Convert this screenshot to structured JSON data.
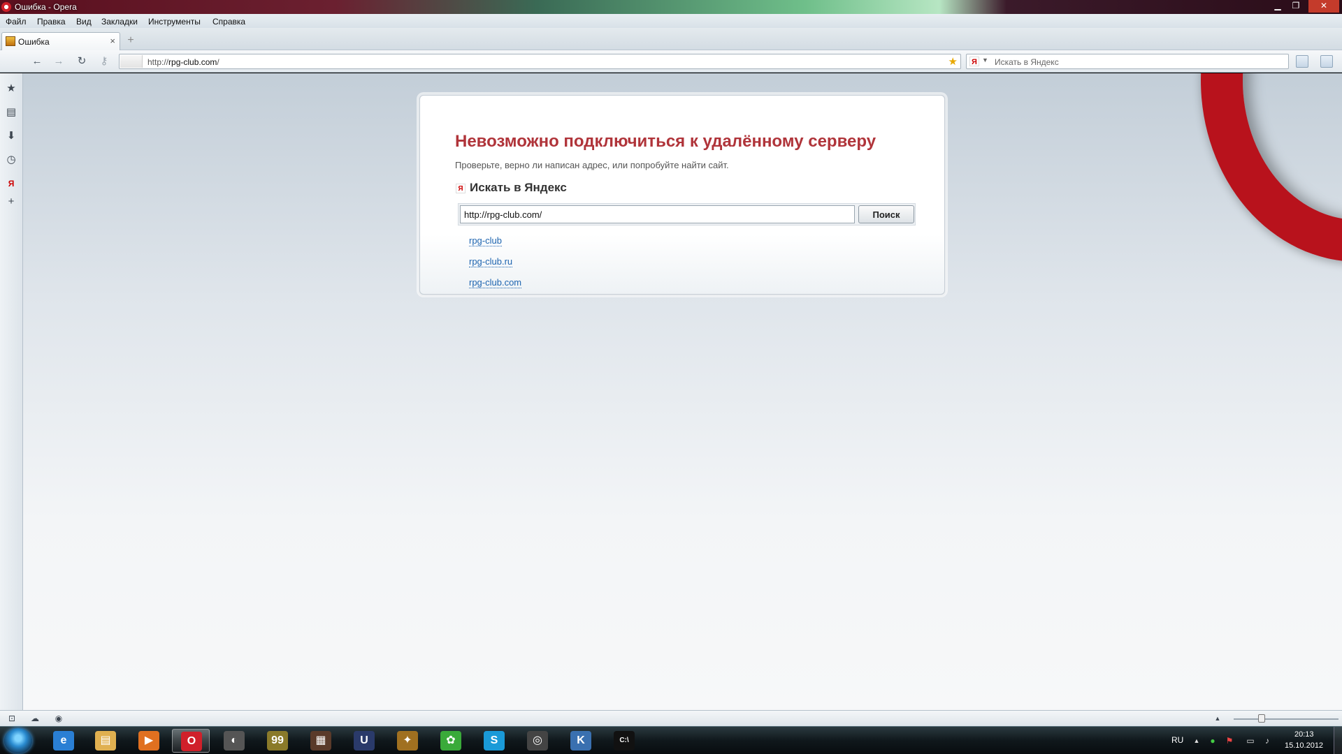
{
  "window": {
    "title": "Ошибка - Opera",
    "minimize": "▁",
    "restore": "❐",
    "close": "✕"
  },
  "menu": [
    "Файл",
    "Правка",
    "Вид",
    "Закладки",
    "Инструменты",
    "Справка"
  ],
  "tab": {
    "title": "Ошибка",
    "close": "×",
    "new_tab": "+"
  },
  "nav": {
    "back": "←",
    "forward": "→",
    "reload": "↻",
    "key": "⚷",
    "url_prefix": "http://",
    "url_host": "rpg-club.com",
    "url_suffix": "/",
    "star": "★",
    "search_engine": "Я",
    "search_dropdown": "▼",
    "search_placeholder": "Искать в Яндекс"
  },
  "sidebar": [
    "★",
    "▤",
    "⬇",
    "◷",
    "Я",
    "+"
  ],
  "error": {
    "title": "Невозможно подключиться к удалённому серверу",
    "subtitle": "Проверьте, верно ли написан адрес, или попробуйте найти сайт.",
    "search_heading": "Искать в Яндекс",
    "yandex_icon": "Я",
    "search_value": "http://rpg-club.com/",
    "search_button": "Поиск",
    "suggestions": [
      "rpg-club",
      "rpg-club.ru",
      "rpg-club.com"
    ]
  },
  "statusbar": {
    "icons": [
      "⊡",
      "☁",
      "◉"
    ],
    "up_arrow": "▲"
  },
  "taskbar": {
    "apps": [
      {
        "name": "ie",
        "glyph": "e",
        "color": "#2a7fd4"
      },
      {
        "name": "explorer",
        "glyph": "▤",
        "color": "#e0b050"
      },
      {
        "name": "media-player",
        "glyph": "▶",
        "color": "#e07020"
      },
      {
        "name": "opera",
        "glyph": "O",
        "color": "#d0202a"
      },
      {
        "name": "steam",
        "glyph": "◐",
        "color": "#555"
      },
      {
        "name": "app-99",
        "glyph": "99",
        "color": "#8a7a2a"
      },
      {
        "name": "game-1",
        "glyph": "▦",
        "color": "#5a3a2a"
      },
      {
        "name": "game-2",
        "glyph": "U",
        "color": "#2a3a6a"
      },
      {
        "name": "game-3",
        "glyph": "✦",
        "color": "#a07020"
      },
      {
        "name": "icq",
        "glyph": "✿",
        "color": "#3aaa3a"
      },
      {
        "name": "skype",
        "glyph": "S",
        "color": "#1a9ad8"
      },
      {
        "name": "game-4",
        "glyph": "◎",
        "color": "#444"
      },
      {
        "name": "app-k",
        "glyph": "K",
        "color": "#3a70b0"
      },
      {
        "name": "cmd",
        "glyph": "C:\\",
        "color": "#111"
      }
    ],
    "language": "RU",
    "time": "20:13",
    "date": "15.10.2012",
    "tray_up": "▲",
    "tray_icons": [
      "●",
      "⚑",
      "▭",
      "♪"
    ]
  }
}
